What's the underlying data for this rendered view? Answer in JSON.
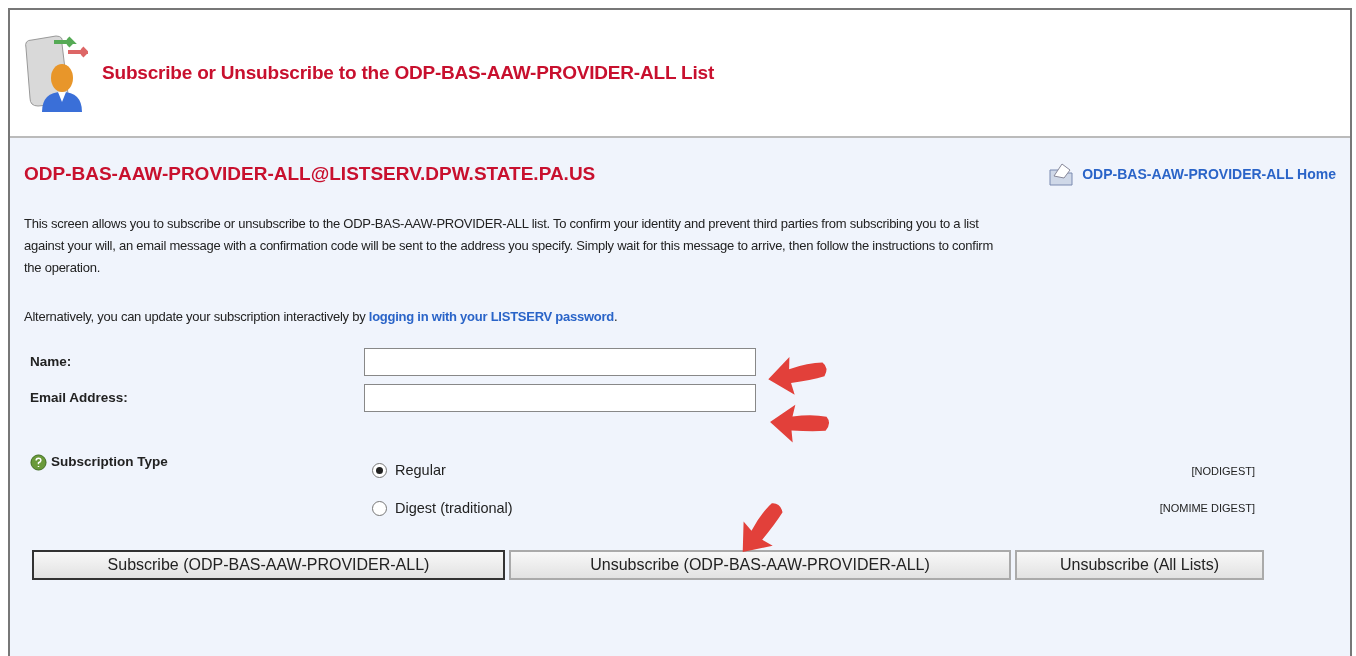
{
  "header": {
    "title": "Subscribe or Unsubscribe to the ODP-BAS-AAW-PROVIDER-ALL List"
  },
  "panel": {
    "address": "ODP-BAS-AAW-PROVIDER-ALL@LISTSERV.DPW.STATE.PA.US",
    "home_link": "ODP-BAS-AAW-PROVIDER-ALL Home",
    "description": "This screen allows you to subscribe or unsubscribe to the ODP-BAS-AAW-PROVIDER-ALL list. To confirm your identity and prevent third parties from subscribing you to a list against your will, an email message with a confirmation code will be sent to the address you specify. Simply wait for this message to arrive, then follow the instructions to confirm the operation.",
    "alternative": {
      "before": "Alternatively, you can update your subscription interactively by ",
      "link": "logging in with your LISTSERV password",
      "after": "."
    }
  },
  "fields": [
    {
      "label": "Name:"
    },
    {
      "label": "Email Address:"
    }
  ],
  "subscription_type": {
    "label": "Subscription Type",
    "options": [
      {
        "label": "Regular",
        "tag": "[NODIGEST]",
        "selected": true
      },
      {
        "label": "Digest (traditional)",
        "tag": "[NOMIME DIGEST]",
        "selected": false
      }
    ]
  },
  "buttons": [
    {
      "label": "Subscribe (ODP-BAS-AAW-PROVIDER-ALL)",
      "focused": true
    },
    {
      "label": "Unsubscribe (ODP-BAS-AAW-PROVIDER-ALL)",
      "focused": false
    },
    {
      "label": "Unsubscribe (All Lists)",
      "focused": false
    }
  ]
}
